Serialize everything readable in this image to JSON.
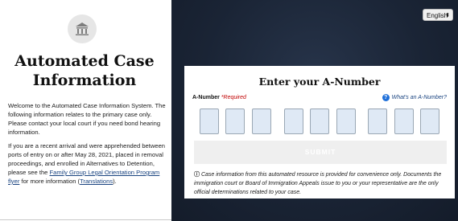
{
  "left": {
    "title_line1": "Automated Case",
    "title_line2": "Information",
    "paragraph1": "Welcome to the Automated Case Information System. The following information relates to the primary case only. Please contact your local court if you need bond hearing information.",
    "paragraph2_prefix": "If you are a recent arrival and were apprehended between ports of entry on or after May 28, 2021, placed in removal proceedings, and enrolled in Alternatives to Detention, please see the ",
    "flyer_link": "Family Group Legal Orientation Program flyer",
    "paragraph2_middle": " for more information (",
    "translations_link": "Translations",
    "paragraph2_suffix": ")."
  },
  "language_select": {
    "value": "English"
  },
  "card": {
    "title": "Enter your A-Number",
    "anumber_label": "A-Number",
    "required_label": "*Required",
    "help_link": "What's an A-Number?",
    "digits": [
      "",
      "",
      "",
      "",
      "",
      "",
      "",
      "",
      ""
    ],
    "submit_label": "SUBMIT",
    "disclaimer": "Case information from this automated resource is provided for convenience only. Documents the immigration court or Board of Immigration Appeals issue to you or your representative are the only official determinations related to your case."
  },
  "icons": {
    "logo": "courthouse-icon",
    "help": "question-circle-icon",
    "info": "info-icon",
    "select_arrow": "updown-arrow-icon"
  },
  "colors": {
    "background_dark": "#1a2435",
    "link": "#1a4480",
    "required": "#c00000",
    "digit_fill": "#dfe9f5",
    "submit_disabled": "#efefef"
  }
}
